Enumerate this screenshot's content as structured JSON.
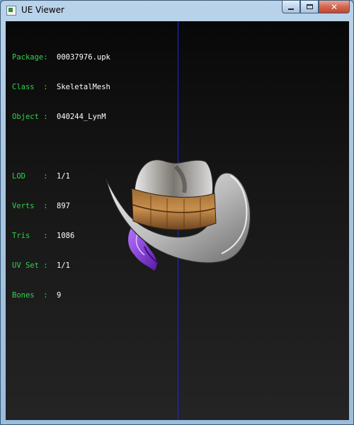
{
  "window": {
    "title": "UE Viewer",
    "buttons": [
      "minimize",
      "maximize",
      "close"
    ]
  },
  "info_block_1": [
    {
      "label": "Package",
      "value": "00037976.upk"
    },
    {
      "label": "Class",
      "value": "SkeletalMesh"
    },
    {
      "label": "Object",
      "value": "040244_LynM"
    }
  ],
  "info_block_2": [
    {
      "label": "LOD",
      "value": "1/1"
    },
    {
      "label": "Verts",
      "value": "897"
    },
    {
      "label": "Tris",
      "value": "1086"
    },
    {
      "label": "UV Set",
      "value": "1/1"
    },
    {
      "label": "Bones",
      "value": "9"
    }
  ],
  "colors": {
    "label": "#2fd24a",
    "value": "#ffffff",
    "axis": "#1a2bd6",
    "background": "#161616"
  },
  "model_icon": "hat-mesh"
}
